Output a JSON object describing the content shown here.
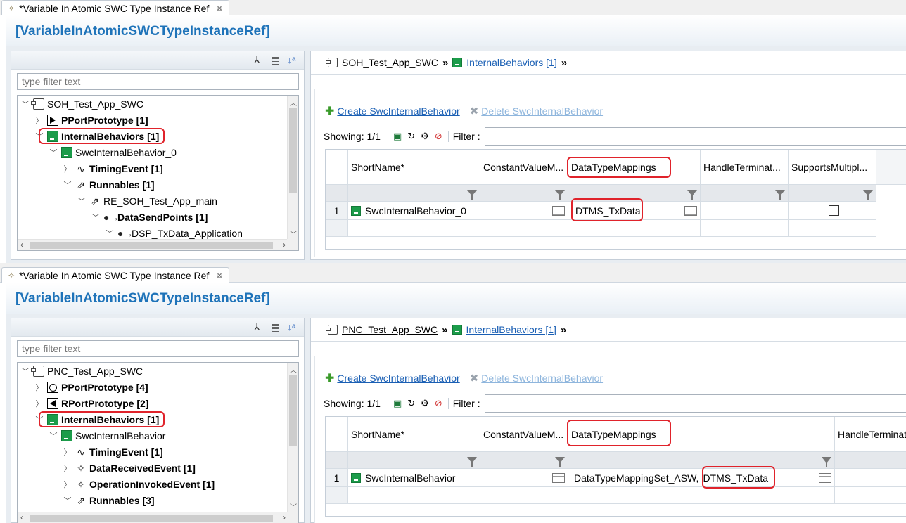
{
  "editors": [
    {
      "tab_title": "*Variable In Atomic SWC Type Instance Ref",
      "header_title": "[VariableInAtomicSWCTypeInstanceRef]",
      "filter_placeholder": "type filter text",
      "tree": [
        {
          "label": "SOH_Test_App_SWC",
          "bold": false
        },
        {
          "label": "PPortPrototype [1]",
          "bold": true
        },
        {
          "label": "InternalBehaviors [1]",
          "bold": true
        },
        {
          "label": "SwcInternalBehavior_0",
          "bold": false
        },
        {
          "label": "TimingEvent [1]",
          "bold": true
        },
        {
          "label": "Runnables [1]",
          "bold": true
        },
        {
          "label": "RE_SOH_Test_App_main",
          "bold": false
        },
        {
          "label": "DataSendPoints [1]",
          "bold": true
        },
        {
          "label": "DSP_TxData_Application",
          "bold": false
        }
      ],
      "breadcrumb": {
        "root": "SOH_Test_App_SWC",
        "child": "InternalBehaviors [1]"
      },
      "actions": {
        "create": "Create SwcInternalBehavior",
        "delete": "Delete SwcInternalBehavior"
      },
      "showing": "Showing: 1/1",
      "filter_label": "Filter :",
      "columns": [
        "ShortName*",
        "ConstantValueM...",
        "DataTypeMappings",
        "HandleTerminat...",
        "SupportsMultipl..."
      ],
      "rows": [
        {
          "num": "1",
          "short_name": "SwcInternalBehavior_0",
          "data_type_mappings": "DTMS_TxData"
        }
      ]
    },
    {
      "tab_title": "*Variable In Atomic SWC Type Instance Ref",
      "header_title": "[VariableInAtomicSWCTypeInstanceRef]",
      "filter_placeholder": "type filter text",
      "tree": [
        {
          "label": "PNC_Test_App_SWC",
          "bold": false
        },
        {
          "label": "PPortPrototype [4]",
          "bold": true
        },
        {
          "label": "RPortPrototype [2]",
          "bold": true
        },
        {
          "label": "InternalBehaviors [1]",
          "bold": true
        },
        {
          "label": "SwcInternalBehavior",
          "bold": false
        },
        {
          "label": "TimingEvent [1]",
          "bold": true
        },
        {
          "label": "DataReceivedEvent [1]",
          "bold": true
        },
        {
          "label": "OperationInvokedEvent [1]",
          "bold": true
        },
        {
          "label": "Runnables [3]",
          "bold": true
        }
      ],
      "breadcrumb": {
        "root": "PNC_Test_App_SWC",
        "child": "InternalBehaviors [1]"
      },
      "actions": {
        "create": "Create SwcInternalBehavior",
        "delete": "Delete SwcInternalBehavior"
      },
      "showing": "Showing: 1/1",
      "filter_label": "Filter :",
      "columns": [
        "ShortName*",
        "ConstantValueM...",
        "DataTypeMappings",
        "HandleTerminat..."
      ],
      "rows": [
        {
          "num": "1",
          "short_name": "SwcInternalBehavior",
          "data_type_mappings_a": "DataTypeMappingSet_ASW,",
          "data_type_mappings_b": "DTMS_TxData"
        }
      ]
    }
  ],
  "colors": {
    "accent": "#1e73b9",
    "highlight": "#e0232b",
    "link": "#1a5fb4",
    "tree_icon_green": "#1b9c4a"
  }
}
